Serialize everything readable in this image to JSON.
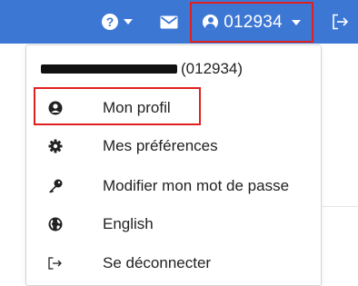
{
  "topbar": {
    "help_symbol": "?",
    "user_code": "012934",
    "accent": "#3c77d4",
    "highlight": "#e02020"
  },
  "dropdown": {
    "header_code": "(012934)",
    "items": [
      {
        "label": "Mon profil",
        "icon": "user-circle-icon"
      },
      {
        "label": "Mes préférences",
        "icon": "gear-icon"
      },
      {
        "label": "Modifier mon mot de passe",
        "icon": "key-icon"
      },
      {
        "label": "English",
        "icon": "globe-icon"
      },
      {
        "label": "Se déconnecter",
        "icon": "sign-out-icon"
      }
    ]
  }
}
